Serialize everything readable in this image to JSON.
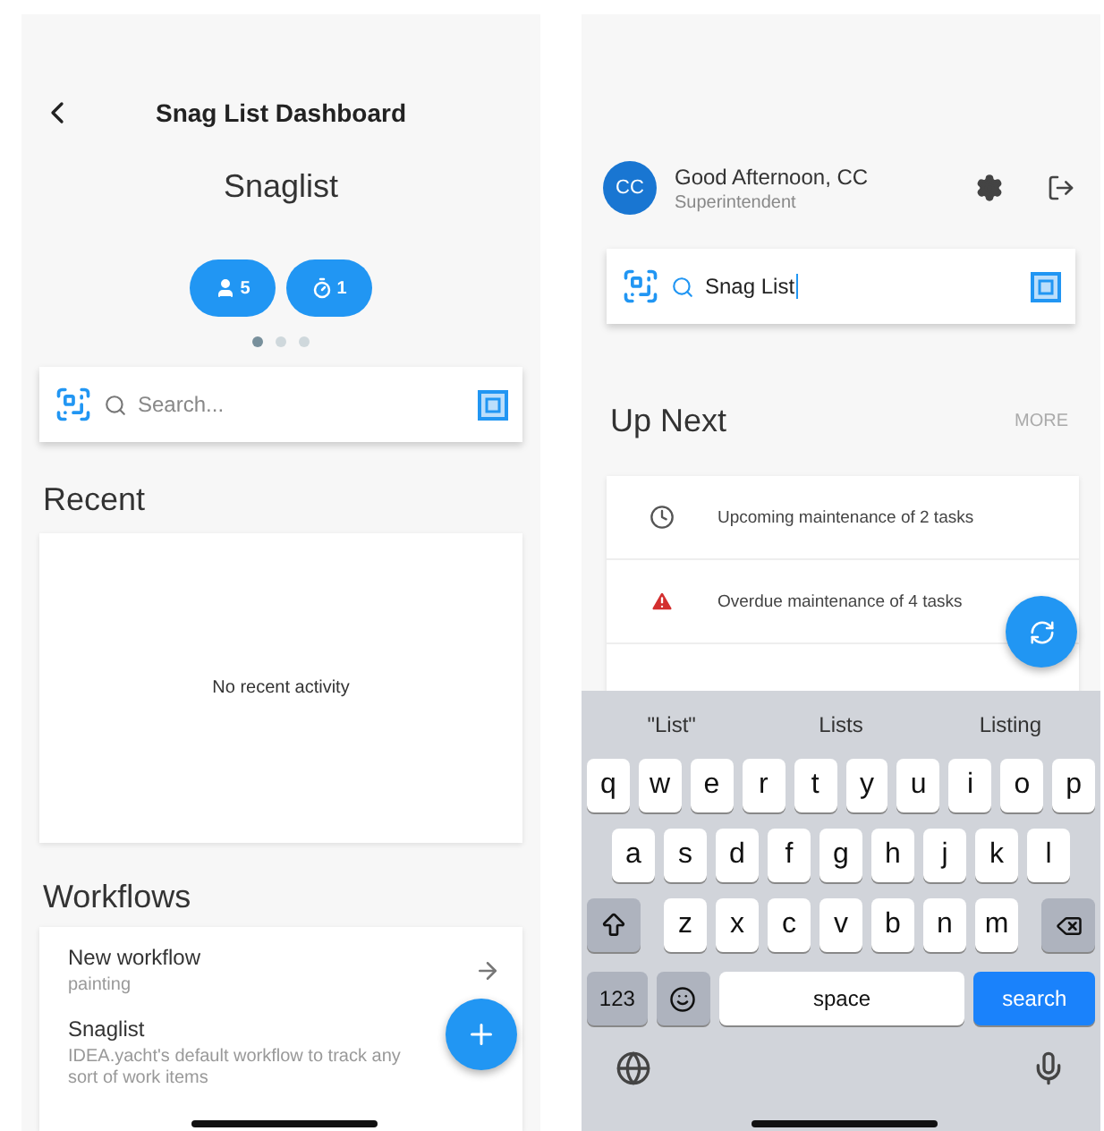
{
  "dashboard": {
    "title": "Snag List Dashboard",
    "subtitle": "Snaglist",
    "chips": [
      {
        "kind": "people",
        "count": "5"
      },
      {
        "kind": "timer",
        "count": "1"
      }
    ],
    "pager": [
      {
        "selected": true
      },
      {
        "selected": false
      },
      {
        "selected": false
      }
    ],
    "search": {
      "placeholder": "Search..."
    },
    "recent": {
      "heading": "Recent",
      "empty": "No recent activity"
    },
    "workflows": {
      "heading": "Workflows",
      "items": [
        {
          "name": "New workflow",
          "description": "painting",
          "arrow": true
        },
        {
          "name": "Snaglist",
          "description": "IDEA.yacht's default workflow to track any sort of work items",
          "arrow": false
        }
      ]
    }
  },
  "home": {
    "avatar": "CC",
    "greeting": "Good Afternoon, CC",
    "role": "Superintendent",
    "search": {
      "value": "Snag List"
    },
    "up_next": {
      "heading": "Up Next",
      "more": "MORE",
      "items": [
        {
          "kind": "upcoming",
          "text": "Upcoming maintenance of 2 tasks"
        },
        {
          "kind": "overdue",
          "text": "Overdue maintenance of 4 tasks"
        }
      ]
    }
  },
  "keyboard": {
    "suggestions": [
      "\"List\"",
      "Lists",
      "Listing"
    ],
    "rows": [
      [
        "q",
        "w",
        "e",
        "r",
        "t",
        "y",
        "u",
        "i",
        "o",
        "p"
      ],
      [
        "a",
        "s",
        "d",
        "f",
        "g",
        "h",
        "j",
        "k",
        "l"
      ],
      [
        "z",
        "x",
        "c",
        "v",
        "b",
        "n",
        "m"
      ]
    ],
    "numbers": "123",
    "space": "space",
    "action": "search"
  }
}
